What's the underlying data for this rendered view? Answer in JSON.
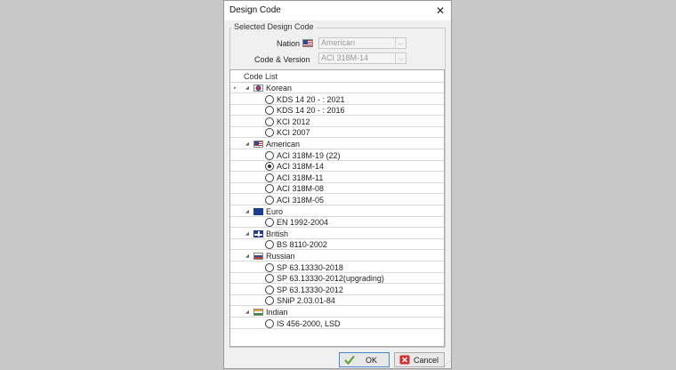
{
  "dialog": {
    "title": "Design Code",
    "close_glyph": "✕"
  },
  "group": {
    "label": "Selected Design Code"
  },
  "nation": {
    "label": "Nation",
    "value": "American",
    "flag": "us-flag-icon"
  },
  "code_version": {
    "label": "Code & Version",
    "value": "ACI 318M-14"
  },
  "list": {
    "header": "Code List",
    "rows": [
      {
        "type": "group",
        "label": "Korean",
        "expander": "▸",
        "flag": "korean-flag-icon"
      },
      {
        "type": "item",
        "label": "KDS 14 20 - : 2021",
        "checked": false
      },
      {
        "type": "item",
        "label": "KDS 14 20 - : 2016",
        "checked": false
      },
      {
        "type": "item",
        "label": "KCI 2012",
        "checked": false
      },
      {
        "type": "item",
        "label": "KCI 2007",
        "checked": false
      },
      {
        "type": "group",
        "label": "American",
        "flag": "american-flag-icon"
      },
      {
        "type": "item",
        "label": "ACI 318M-19 (22)",
        "checked": false
      },
      {
        "type": "item",
        "label": "ACI 318M-14",
        "checked": true
      },
      {
        "type": "item",
        "label": "ACI 318M-11",
        "checked": false
      },
      {
        "type": "item",
        "label": "ACI 318M-08",
        "checked": false
      },
      {
        "type": "item",
        "label": "ACI 318M-05",
        "checked": false
      },
      {
        "type": "group",
        "label": "Euro",
        "flag": "euro-flag-icon"
      },
      {
        "type": "item",
        "label": "EN 1992-2004",
        "checked": false
      },
      {
        "type": "group",
        "label": "British",
        "flag": "british-flag-icon"
      },
      {
        "type": "item",
        "label": "BS 8110-2002",
        "checked": false
      },
      {
        "type": "group",
        "label": "Russian",
        "flag": "russian-flag-icon"
      },
      {
        "type": "item",
        "label": "SP 63.13330-2018",
        "checked": false
      },
      {
        "type": "item",
        "label": "SP 63.13330-2012(upgrading)",
        "checked": false
      },
      {
        "type": "item",
        "label": "SP 63.13330-2012",
        "checked": false
      },
      {
        "type": "item",
        "label": "SNiP 2.03.01-84",
        "checked": false
      },
      {
        "type": "group",
        "label": "Indian",
        "flag": "indian-flag-icon"
      },
      {
        "type": "item",
        "label": "IS 456-2000, LSD",
        "checked": false
      }
    ]
  },
  "buttons": {
    "ok": "OK",
    "cancel": "Cancel"
  },
  "colors": {
    "ok_check": "#5aa028",
    "cancel_red": "#d03030",
    "accent": "#4a86c8"
  }
}
